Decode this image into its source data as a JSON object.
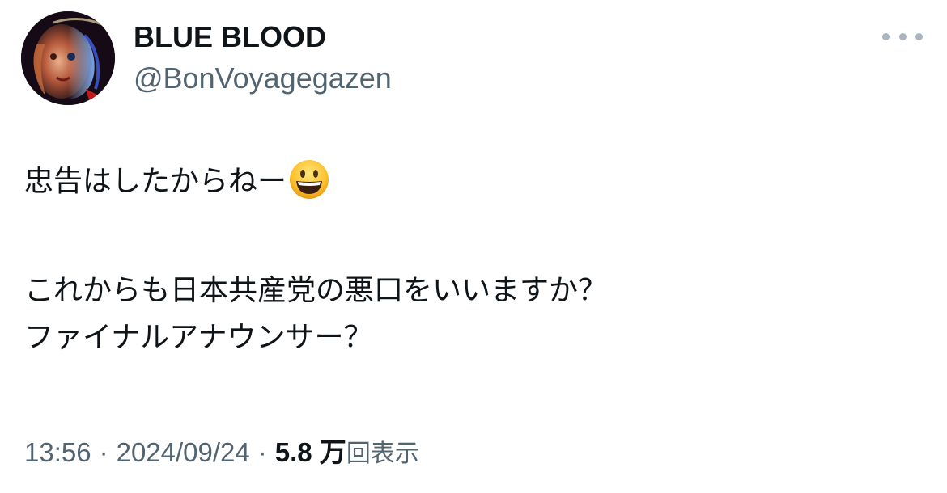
{
  "author": {
    "display_name": "BLUE BLOOD",
    "handle": "@BonVoyagegazen",
    "avatar_icon": "profile-avatar"
  },
  "more_icon": "more-options-icon",
  "tweet": {
    "line1": "忠告はしたからねー",
    "line1_emoji": "grinning-face-emoji",
    "line2": "これからも日本共産党の悪口をいいますか？",
    "line3": "ファイナルアナウンサー？"
  },
  "meta": {
    "time": "13:56",
    "separator": "·",
    "date": "2024/09/24",
    "views_count": "5.8 万",
    "views_label": "回表示"
  },
  "colors": {
    "text_primary": "#0f1419",
    "text_secondary": "#536471",
    "more_dots": "#aab5bf",
    "background": "#ffffff"
  }
}
